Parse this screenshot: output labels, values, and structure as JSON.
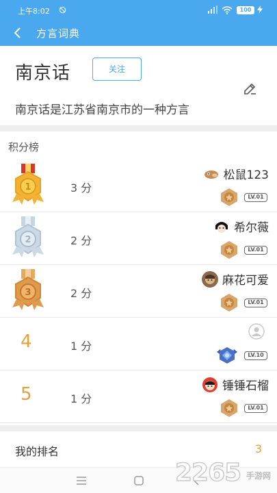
{
  "status_bar": {
    "time": "上午8:02",
    "battery": "100"
  },
  "app_bar": {
    "title": "方言词典"
  },
  "dialect": {
    "name": "南京话",
    "follow_label": "关注",
    "description": "南京话是江苏省南京市的一种方言"
  },
  "leaderboard": {
    "title": "积分榜",
    "rows": [
      {
        "rank": "1",
        "score": "3 分",
        "username": "松鼠123",
        "level": "LV.01",
        "medal": "gold"
      },
      {
        "rank": "2",
        "score": "2 分",
        "username": "希尔薇",
        "level": "LV.01",
        "medal": "silver"
      },
      {
        "rank": "3",
        "score": "2 分",
        "username": "麻花可爱",
        "level": "LV.01",
        "medal": "bronze"
      },
      {
        "rank": "4",
        "score": "1 分",
        "username": "",
        "level": "LV.10",
        "medal": "none"
      },
      {
        "rank": "5",
        "score": "1 分",
        "username": "锤锤石榴",
        "level": "LV.01",
        "medal": "none"
      }
    ]
  },
  "my_rank": {
    "label": "我的排名",
    "value": "3"
  },
  "watermark": {
    "main": "2265",
    "sub": "手游网"
  },
  "colors": {
    "primary": "#4aa8ee",
    "accent": "#e8a03c",
    "gold": "#f2b233",
    "silver": "#b9cbd9",
    "bronze": "#e09a4c"
  }
}
